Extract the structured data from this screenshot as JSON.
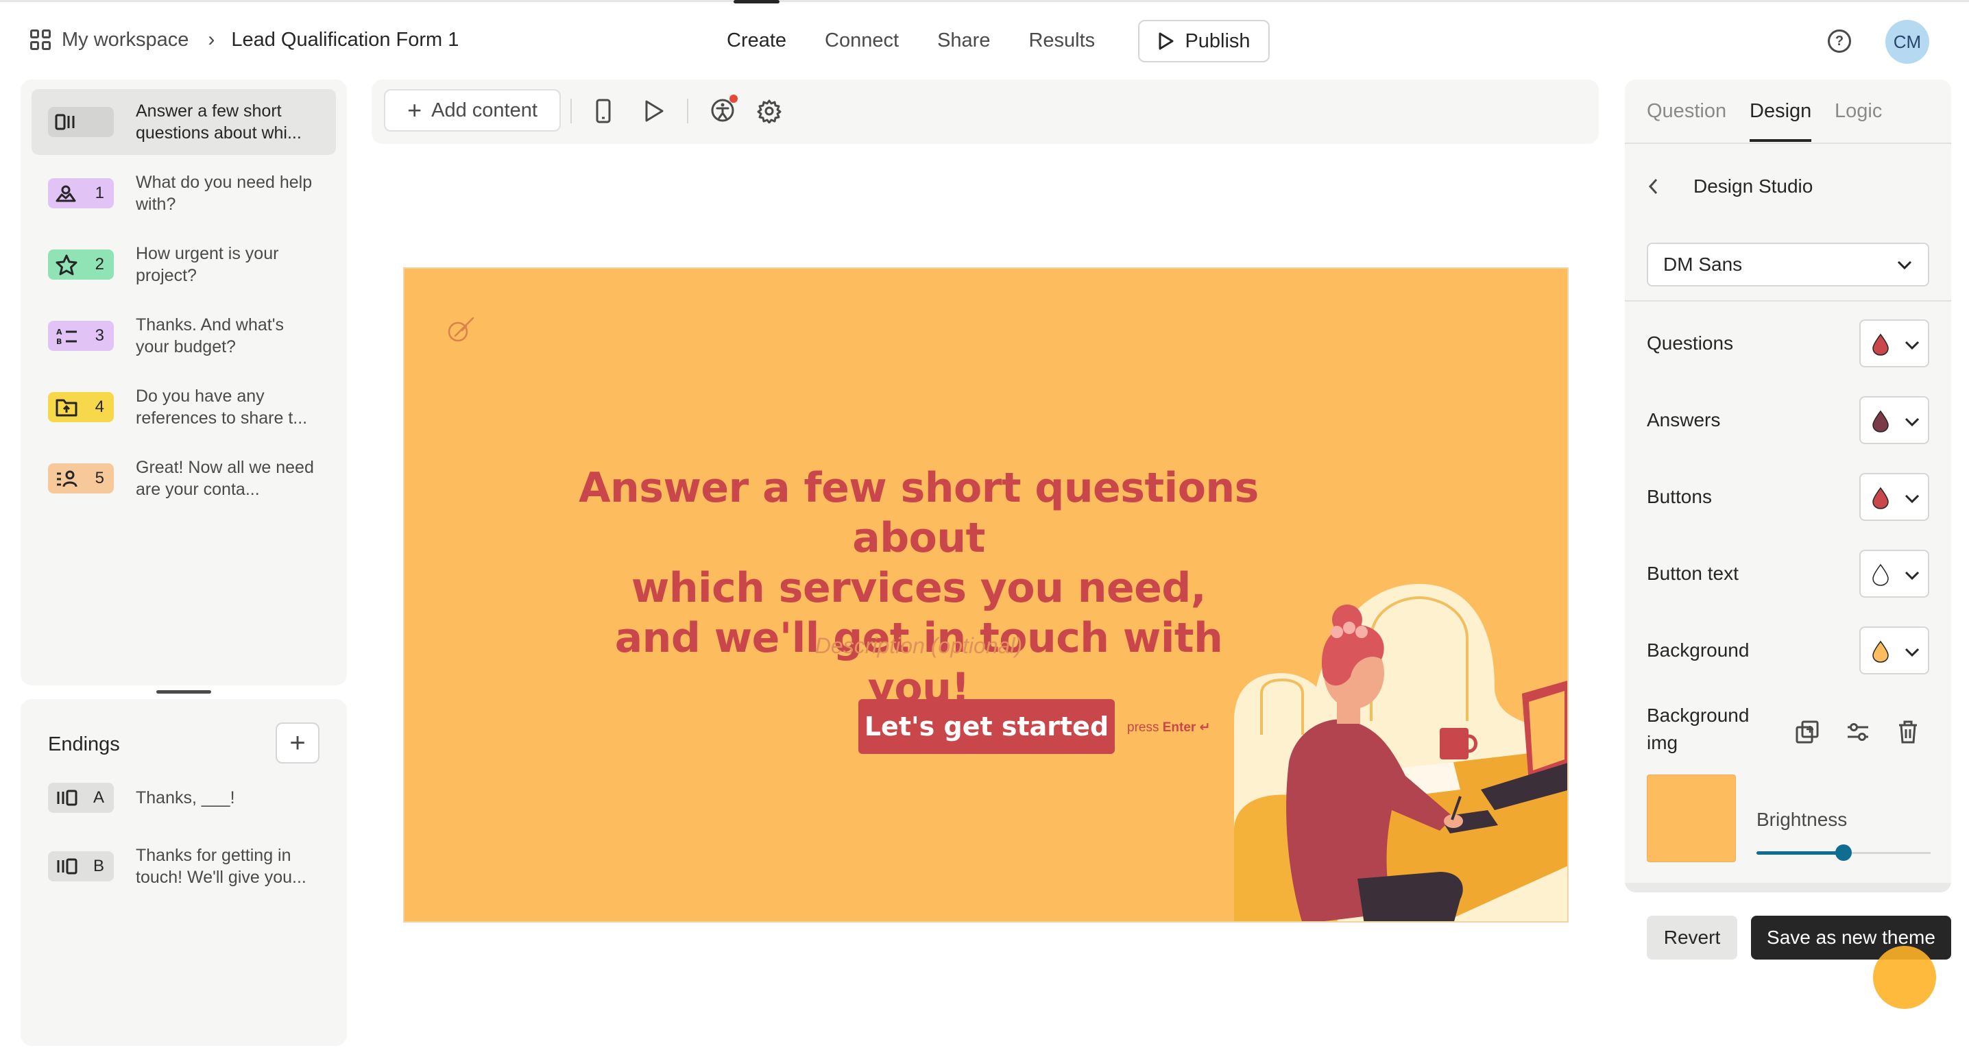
{
  "header": {
    "workspace": "My workspace",
    "separator": "›",
    "form_name": "Lead Qualification Form 1",
    "tabs": [
      "Create",
      "Connect",
      "Share",
      "Results"
    ],
    "publish": "Publish",
    "avatar": "CM"
  },
  "questions": [
    {
      "number": "",
      "text": "Answer a few short questions about whi...",
      "color": "#e6e6e5",
      "icon": "welcome-screen-icon"
    },
    {
      "number": "1",
      "text": "What do you need help with?",
      "color": "#e1c4f5",
      "icon": "picture-choice-icon"
    },
    {
      "number": "2",
      "text": "How urgent is your project?",
      "color": "#8fe3b4",
      "icon": "star-rating-icon"
    },
    {
      "number": "3",
      "text": "Thanks. And what's your budget?",
      "color": "#e1c4f5",
      "icon": "multiple-choice-icon"
    },
    {
      "number": "4",
      "text": "Do you have any references to share t...",
      "color": "#f7d84a",
      "icon": "file-upload-icon"
    },
    {
      "number": "5",
      "text": "Great! Now all we need are your conta...",
      "color": "#f7c99a",
      "icon": "contact-info-icon"
    }
  ],
  "endings": {
    "title": "Endings",
    "add": "+",
    "items": [
      {
        "letter": "A",
        "text": "Thanks, ___!"
      },
      {
        "letter": "B",
        "text": "Thanks for getting in touch! We'll give you..."
      }
    ]
  },
  "toolbar": {
    "add_content": "Add content"
  },
  "canvas": {
    "title_line1": "Answer a few short questions about",
    "title_line2": "which services you need,",
    "title_line3": "and we'll get in touch with you!",
    "description": "Description (optional)",
    "cta": "Let's get started",
    "press": "press",
    "press_key": "Enter ↵",
    "background_color": "#fdbc5d",
    "accent_color": "#c9474b"
  },
  "design": {
    "tabs": [
      "Question",
      "Design",
      "Logic"
    ],
    "studio_title": "Design Studio",
    "font": "DM Sans",
    "colors": [
      {
        "label": "Questions",
        "color": "#c9474b"
      },
      {
        "label": "Answers",
        "color": "#7a3b47"
      },
      {
        "label": "Buttons",
        "color": "#c9474b"
      },
      {
        "label": "Button text",
        "color": "#ffffff"
      },
      {
        "label": "Background",
        "color": "#fdbc5d"
      }
    ],
    "bg_img_label_1": "Background",
    "bg_img_label_2": "img",
    "brightness_label": "Brightness",
    "brightness_value": 0.5,
    "revert": "Revert",
    "save_theme": "Save as new theme"
  }
}
